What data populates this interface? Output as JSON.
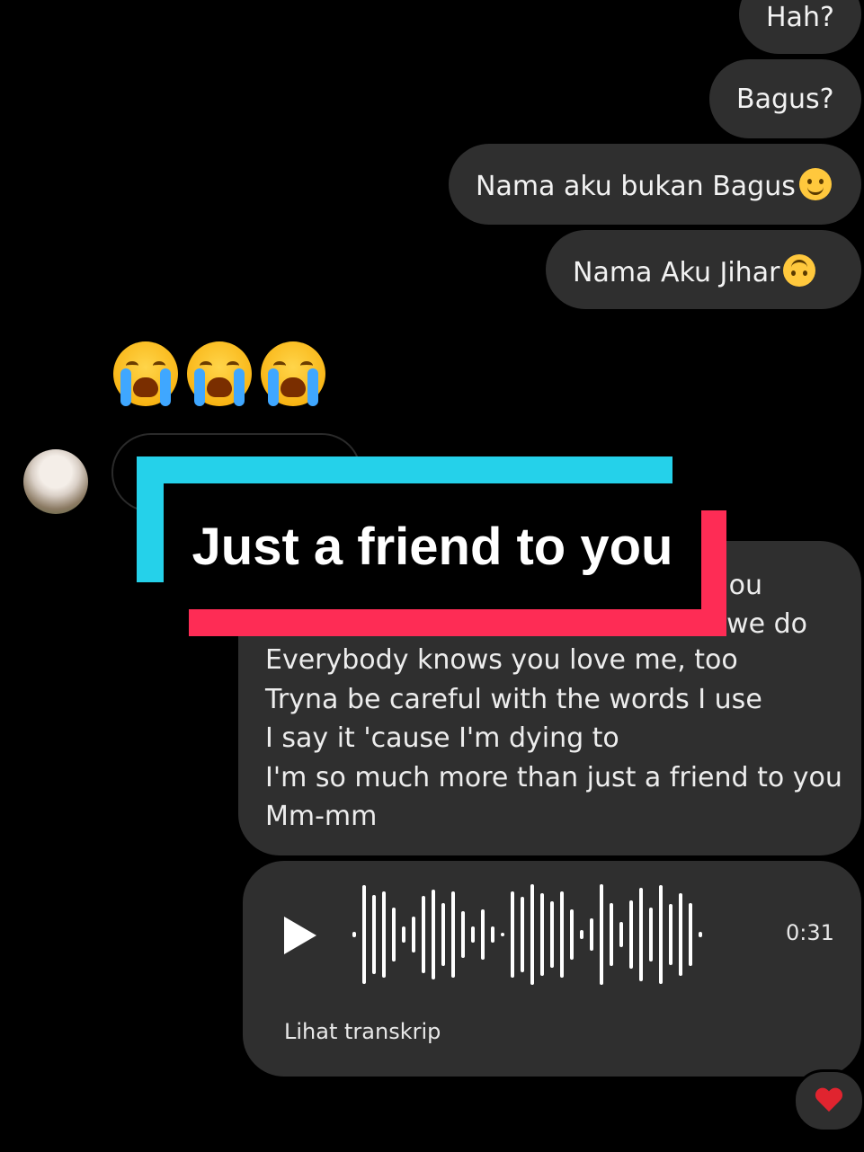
{
  "messages": {
    "m1": "Hah?",
    "m2": "Bagus?",
    "m3": "Nama aku bukan Bagus",
    "m4": "Nama Aku Jihar"
  },
  "emojis": {
    "slight_smile": "slight-smile-icon",
    "upside_down": "upside-down-face-icon",
    "crying": "loudly-crying-face-icon"
  },
  "lyrics": {
    "line1_partial": "ou",
    "line2_partial": "we do",
    "line3": "Everybody knows you love me, too",
    "line4": "Tryna be careful with the words I use",
    "line5": "I say it 'cause I'm dying to",
    "line6": "I'm so much more than just a friend to you",
    "line7": "Mm-mm"
  },
  "voice_note": {
    "duration": "0:31",
    "transcript_label": "Lihat transkrip"
  },
  "reaction": "heart-icon",
  "caption": "Just a friend to you",
  "colors": {
    "bubble": "#2f2f2f",
    "caption_cyan": "#25d1ea",
    "caption_red": "#fe2c55"
  }
}
